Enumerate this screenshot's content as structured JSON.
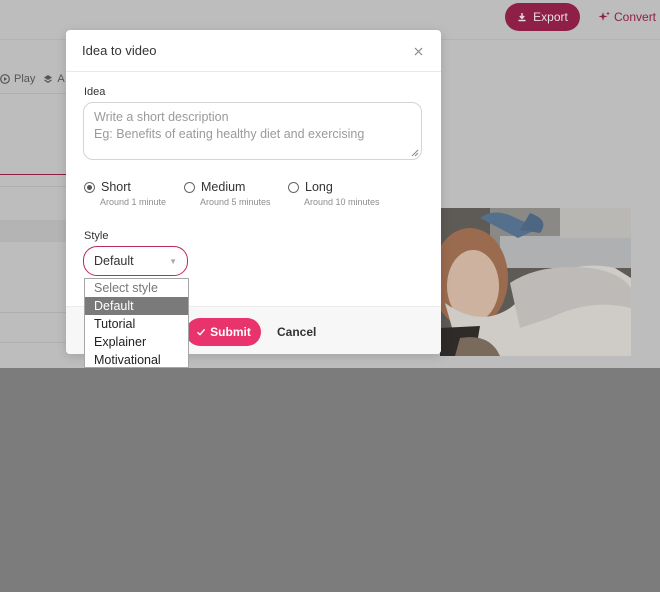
{
  "header": {
    "export_label": "Export",
    "convert_label": "Convert",
    "export_icon": "download-icon",
    "convert_icon": "sparkle-icon"
  },
  "toolbar": {
    "play_label": "Play",
    "play_icon": "play-icon",
    "layers_label": "A",
    "layers_icon": "layers-icon"
  },
  "modal": {
    "title": "Idea to video",
    "close_icon": "close-icon",
    "idea_label": "Idea",
    "idea_placeholder": "Write a short description\nEg: Benefits of eating healthy diet and exercising",
    "idea_value": "",
    "length_options": [
      {
        "label": "Short",
        "sub": "Around 1 minute",
        "selected": true
      },
      {
        "label": "Medium",
        "sub": "Around 5 minutes",
        "selected": false
      },
      {
        "label": "Long",
        "sub": "Around 10 minutes",
        "selected": false
      }
    ],
    "style_label": "Style",
    "style_value": "Default",
    "submit_label": "Submit",
    "cancel_label": "Cancel"
  },
  "style_dropdown": {
    "options": [
      "Select style",
      "Default",
      "Tutorial",
      "Explainer",
      "Motivational"
    ],
    "selected_index": 1
  },
  "colors": {
    "accent": "#e8336c",
    "overlay": "#7c7c7c",
    "brand_dim": "#8e1f47"
  }
}
